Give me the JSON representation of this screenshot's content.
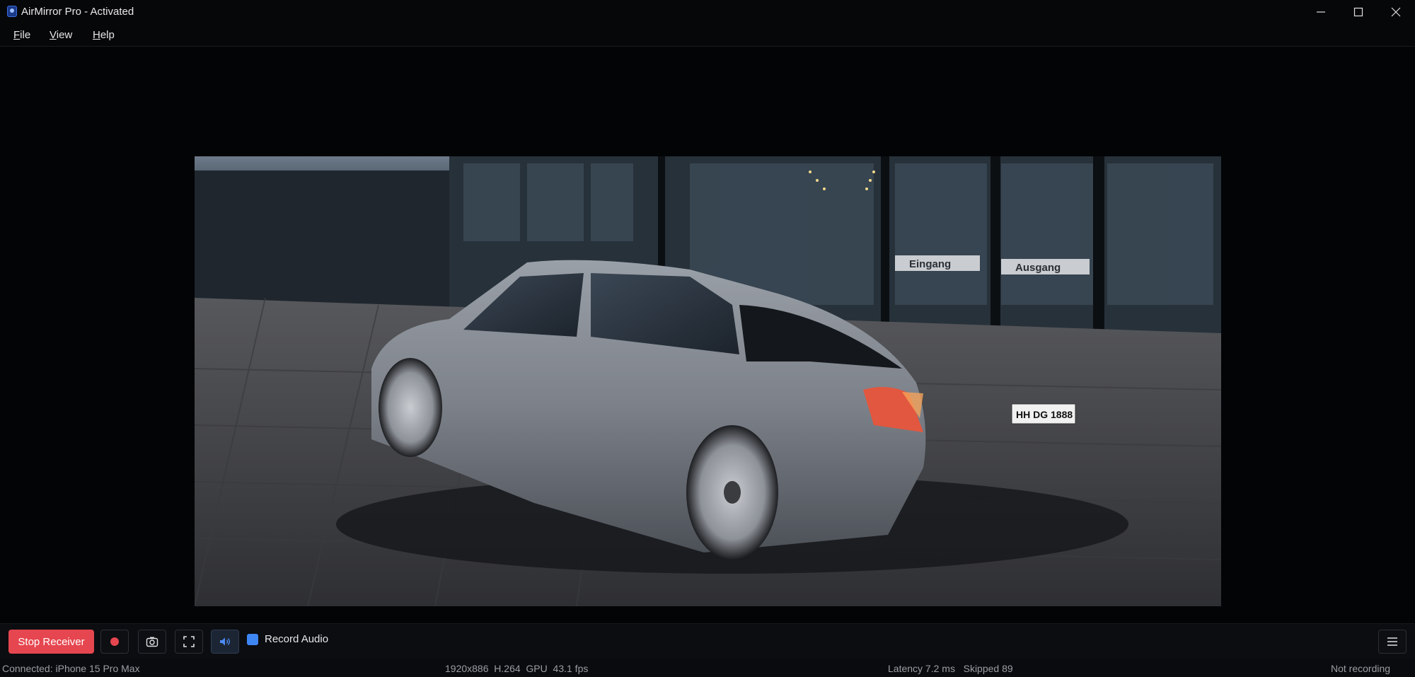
{
  "window": {
    "title": "AirMirror Pro - Activated"
  },
  "menu": {
    "file": "File",
    "view": "View",
    "help": "Help"
  },
  "video": {
    "plate_text": "HH DG 1888",
    "sign_left": "Eingang",
    "sign_right": "Ausgang"
  },
  "toolbar": {
    "stop_label": "Stop Receiver",
    "record_audio_label": "Record Audio",
    "record_audio_checked": true,
    "accent_color": "#3f86f5",
    "stop_color": "#e6464f"
  },
  "status": {
    "connected": "Connected: iPhone 15 Pro Max",
    "stream": "1920x886  H.264  GPU  43.1 fps",
    "latency": "Latency 7.2 ms   Skipped 89",
    "recording": "Not recording"
  }
}
